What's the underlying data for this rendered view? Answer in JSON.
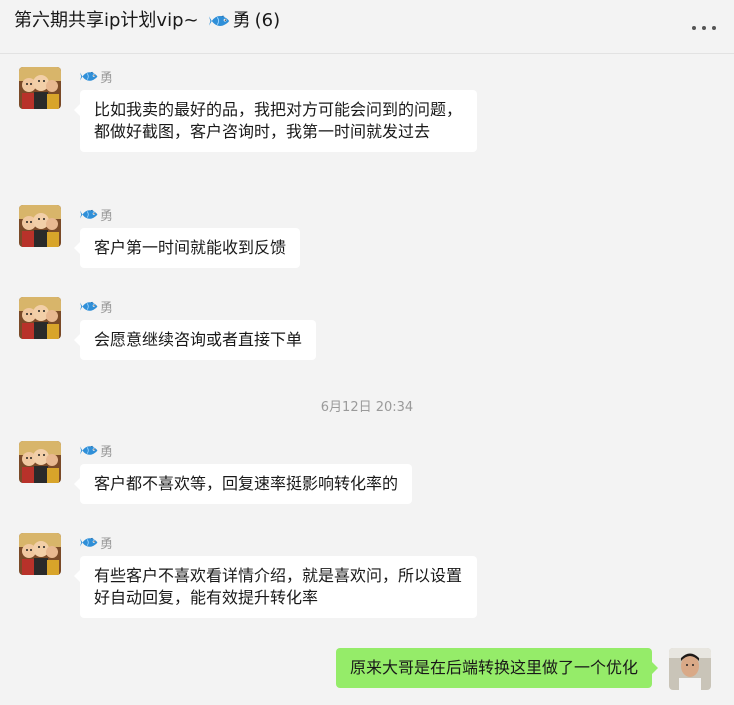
{
  "chat": {
    "title": "第六期共享ip计划vip~",
    "title_member": "勇",
    "member_count": "(6)"
  },
  "icons": {
    "fish": "fish-icon",
    "more": "more-icon"
  },
  "colors": {
    "self_bubble": "#95ec69",
    "other_bubble": "#ffffff",
    "background": "#f3f3f3"
  },
  "messages": [
    {
      "sender": "勇",
      "text": "比如我卖的最好的品，我把对方可能会问到的问题，都做好截图，客户咨询时，我第一时间就发过去"
    },
    {
      "sender": "勇",
      "text": "客户第一时间就能收到反馈"
    },
    {
      "sender": "勇",
      "text": "会愿意继续咨询或者直接下单"
    },
    {
      "sender": "勇",
      "text": "客户都不喜欢等，回复速率挺影响转化率的"
    },
    {
      "sender": "勇",
      "text": "有些客户不喜欢看详情介绍，就是喜欢问，所以设置好自动回复，能有效提升转化率"
    }
  ],
  "timestamp": "6月12日 20:34",
  "self_message": {
    "text": "原来大哥是在后端转换这里做了一个优化"
  }
}
